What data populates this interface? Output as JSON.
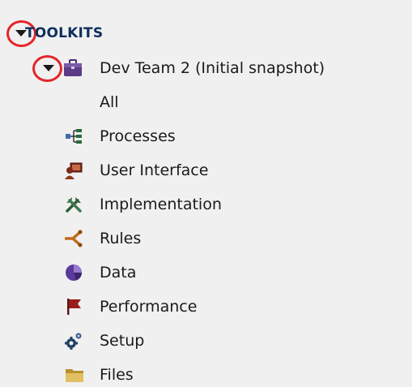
{
  "tree": {
    "header_label": "TOOLKITS",
    "toolkit": {
      "label": "Dev Team 2 (Initial snapshot)",
      "icon": "briefcase-icon",
      "expanded": true
    },
    "items": [
      {
        "label": "All",
        "icon": ""
      },
      {
        "label": "Processes",
        "icon": "processes-icon"
      },
      {
        "label": "User Interface",
        "icon": "user-interface-icon"
      },
      {
        "label": "Implementation",
        "icon": "implementation-icon"
      },
      {
        "label": "Rules",
        "icon": "rules-icon"
      },
      {
        "label": "Data",
        "icon": "data-icon"
      },
      {
        "label": "Performance",
        "icon": "performance-icon"
      },
      {
        "label": "Setup",
        "icon": "setup-icon"
      },
      {
        "label": "Files",
        "icon": "files-icon"
      }
    ]
  },
  "colors": {
    "panel_bg": "#f0f0f0",
    "header_text": "#0f2f5c",
    "highlight_ring": "#e5252a"
  }
}
